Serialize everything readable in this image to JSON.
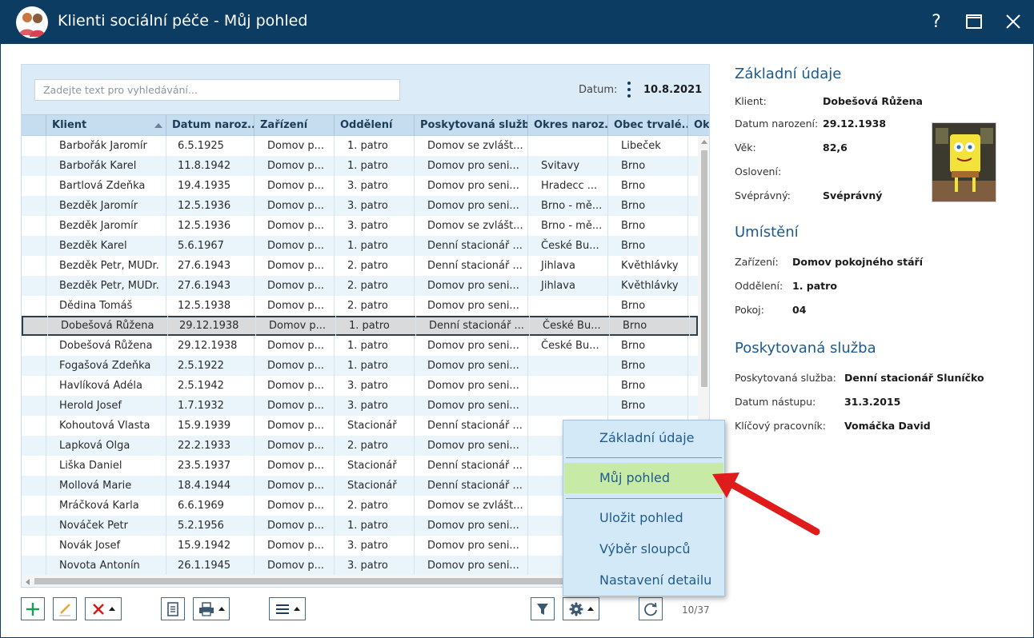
{
  "window": {
    "title": "Klienti sociální péče - Můj pohled",
    "help_label": "?",
    "colors": {
      "titlebar": "#0d3c63",
      "accent": "#1a5a8c",
      "highlight": "#c7eba7",
      "arrow": "#e01b1b"
    }
  },
  "search": {
    "placeholder": "Zadejte text pro vyhledávání...",
    "value": ""
  },
  "date": {
    "label": "Datum:",
    "value": "10.8.2021"
  },
  "grid": {
    "columns": [
      "Klient",
      "Datum naroz...",
      "Zařízení",
      "Oddělení",
      "Poskytovaná služba",
      "Okres naroz...",
      "Obec trvalé...",
      "Okr"
    ],
    "rows": [
      [
        "Barbořák Jaromír",
        "6.5.1925",
        "Domov p...",
        "1. patro",
        "Domov se zvlášt...",
        "",
        "Libeček"
      ],
      [
        "Barbořák Karel",
        "11.8.1942",
        "Domov p...",
        "1. patro",
        "Domov pro seni...",
        "Svitavy",
        "Brno"
      ],
      [
        "Bartlová Zdeňka",
        "19.4.1935",
        "Domov p...",
        "3. patro",
        "Domov pro seni...",
        "Hradecc ...",
        "Brno"
      ],
      [
        "Bezděk Jaromír",
        "12.5.1936",
        "Domov p...",
        "3. patro",
        "Domov pro seni...",
        "Brno - mě...",
        "Brno"
      ],
      [
        "Bezděk Jaromír",
        "12.5.1936",
        "Domov p...",
        "3. patro",
        "Domov se zvlášt...",
        "Brno - mě...",
        "Brno"
      ],
      [
        "Bezděk Karel",
        "5.6.1967",
        "Domov p...",
        "1. patro",
        "Denní stacionář ...",
        "České Bu...",
        "Brno"
      ],
      [
        "Bezděk Petr, MUDr.",
        "27.6.1943",
        "Domov p...",
        "2. patro",
        "Denní stacionář ...",
        "Jihlava",
        "Květhlávky"
      ],
      [
        "Bezděk Petr, MUDr.",
        "27.6.1943",
        "Domov p...",
        "2. patro",
        "Domov pro seni...",
        "Jihlava",
        "Květhlávky"
      ],
      [
        "Dědina Tomáš",
        "12.5.1938",
        "Domov p...",
        "2. patro",
        "Domov pro seni...",
        "",
        "Brno"
      ],
      [
        "Dobešová Růžena",
        "29.12.1938",
        "Domov p...",
        "1. patro",
        "Denní stacionář ...",
        "České Bu...",
        "Brno"
      ],
      [
        "Dobešová Růžena",
        "29.12.1938",
        "Domov p...",
        "1. patro",
        "Domov pro seni...",
        "České Bu...",
        "Brno"
      ],
      [
        "Fogašová Zdeňka",
        "2.5.1922",
        "Domov p...",
        "1. patro",
        "Domov pro seni...",
        "",
        "Brno"
      ],
      [
        "Havlíková Adéla",
        "2.5.1942",
        "Domov p...",
        "3. patro",
        "Domov pro seni...",
        "",
        "Brno"
      ],
      [
        "Herold Josef",
        "1.7.1932",
        "Domov p...",
        "3. patro",
        "Domov pro seni...",
        "",
        "Brno"
      ],
      [
        "Kohoutová Vlasta",
        "15.9.1939",
        "Domov p...",
        "Stacionář",
        "Denní stacionář ...",
        "",
        ""
      ],
      [
        "Lapková Olga",
        "22.2.1933",
        "Domov p...",
        "2. patro",
        "Domov pro seni...",
        "",
        ""
      ],
      [
        "Liška Daniel",
        "23.5.1937",
        "Domov p...",
        "Stacionář",
        "Denní stacionář ...",
        "",
        ""
      ],
      [
        "Mollová Marie",
        "18.4.1944",
        "Domov p...",
        "Stacionář",
        "Denní stacionář ...",
        "",
        ""
      ],
      [
        "Mráčková Karla",
        "6.6.1969",
        "Domov p...",
        "2. patro",
        "Domov se zvlášt...",
        "",
        ""
      ],
      [
        "Nováček Petr",
        "5.2.1956",
        "Domov p...",
        "1. patro",
        "Domov pro seni...",
        "",
        ""
      ],
      [
        "Novák Josef",
        "15.9.1942",
        "Domov p...",
        "3. patro",
        "Domov pro seni...",
        "",
        ""
      ],
      [
        "Novota Antonín",
        "26.1.1945",
        "Domov p...",
        "3. patro",
        "Domov pro seni...",
        "",
        ""
      ]
    ],
    "selected_row": 9
  },
  "toolbar": {
    "buttons": [
      "add-icon",
      "edit-icon",
      "delete-icon",
      "document-icon",
      "print-icon",
      "menu-icon",
      "filter-icon",
      "settings-icon",
      "refresh-icon"
    ],
    "pager": "10/37"
  },
  "details": {
    "basic": {
      "title": "Základní údaje",
      "client_label": "Klient:",
      "client": "Dobešová Růžena",
      "birth_label": "Datum narození:",
      "birth": "29.12.1938",
      "age_label": "Věk:",
      "age": "82,6",
      "salutation_label": "Oslovení:",
      "salutation": "",
      "legal_label": "Svéprávný:",
      "legal": "Svéprávný"
    },
    "placement": {
      "title": "Umístění",
      "facility_label": "Zařízení:",
      "facility": "Domov pokojného stáří",
      "department_label": "Oddělení:",
      "department": "1. patro",
      "room_label": "Pokoj:",
      "room": "04"
    },
    "service": {
      "title": "Poskytovaná služba",
      "service_label": "Poskytovaná služba:",
      "service": "Denní stacionář Sluníčko",
      "start_label": "Datum nástupu:",
      "start": "31.3.2015",
      "worker_label": "Klíčový pracovník:",
      "worker": "Vomáčka David"
    }
  },
  "popup_menu": {
    "items": [
      "Základní údaje",
      "Můj pohled",
      "Uložit pohled",
      "Výběr sloupců",
      "Nastavení detailu"
    ],
    "active": 1
  }
}
